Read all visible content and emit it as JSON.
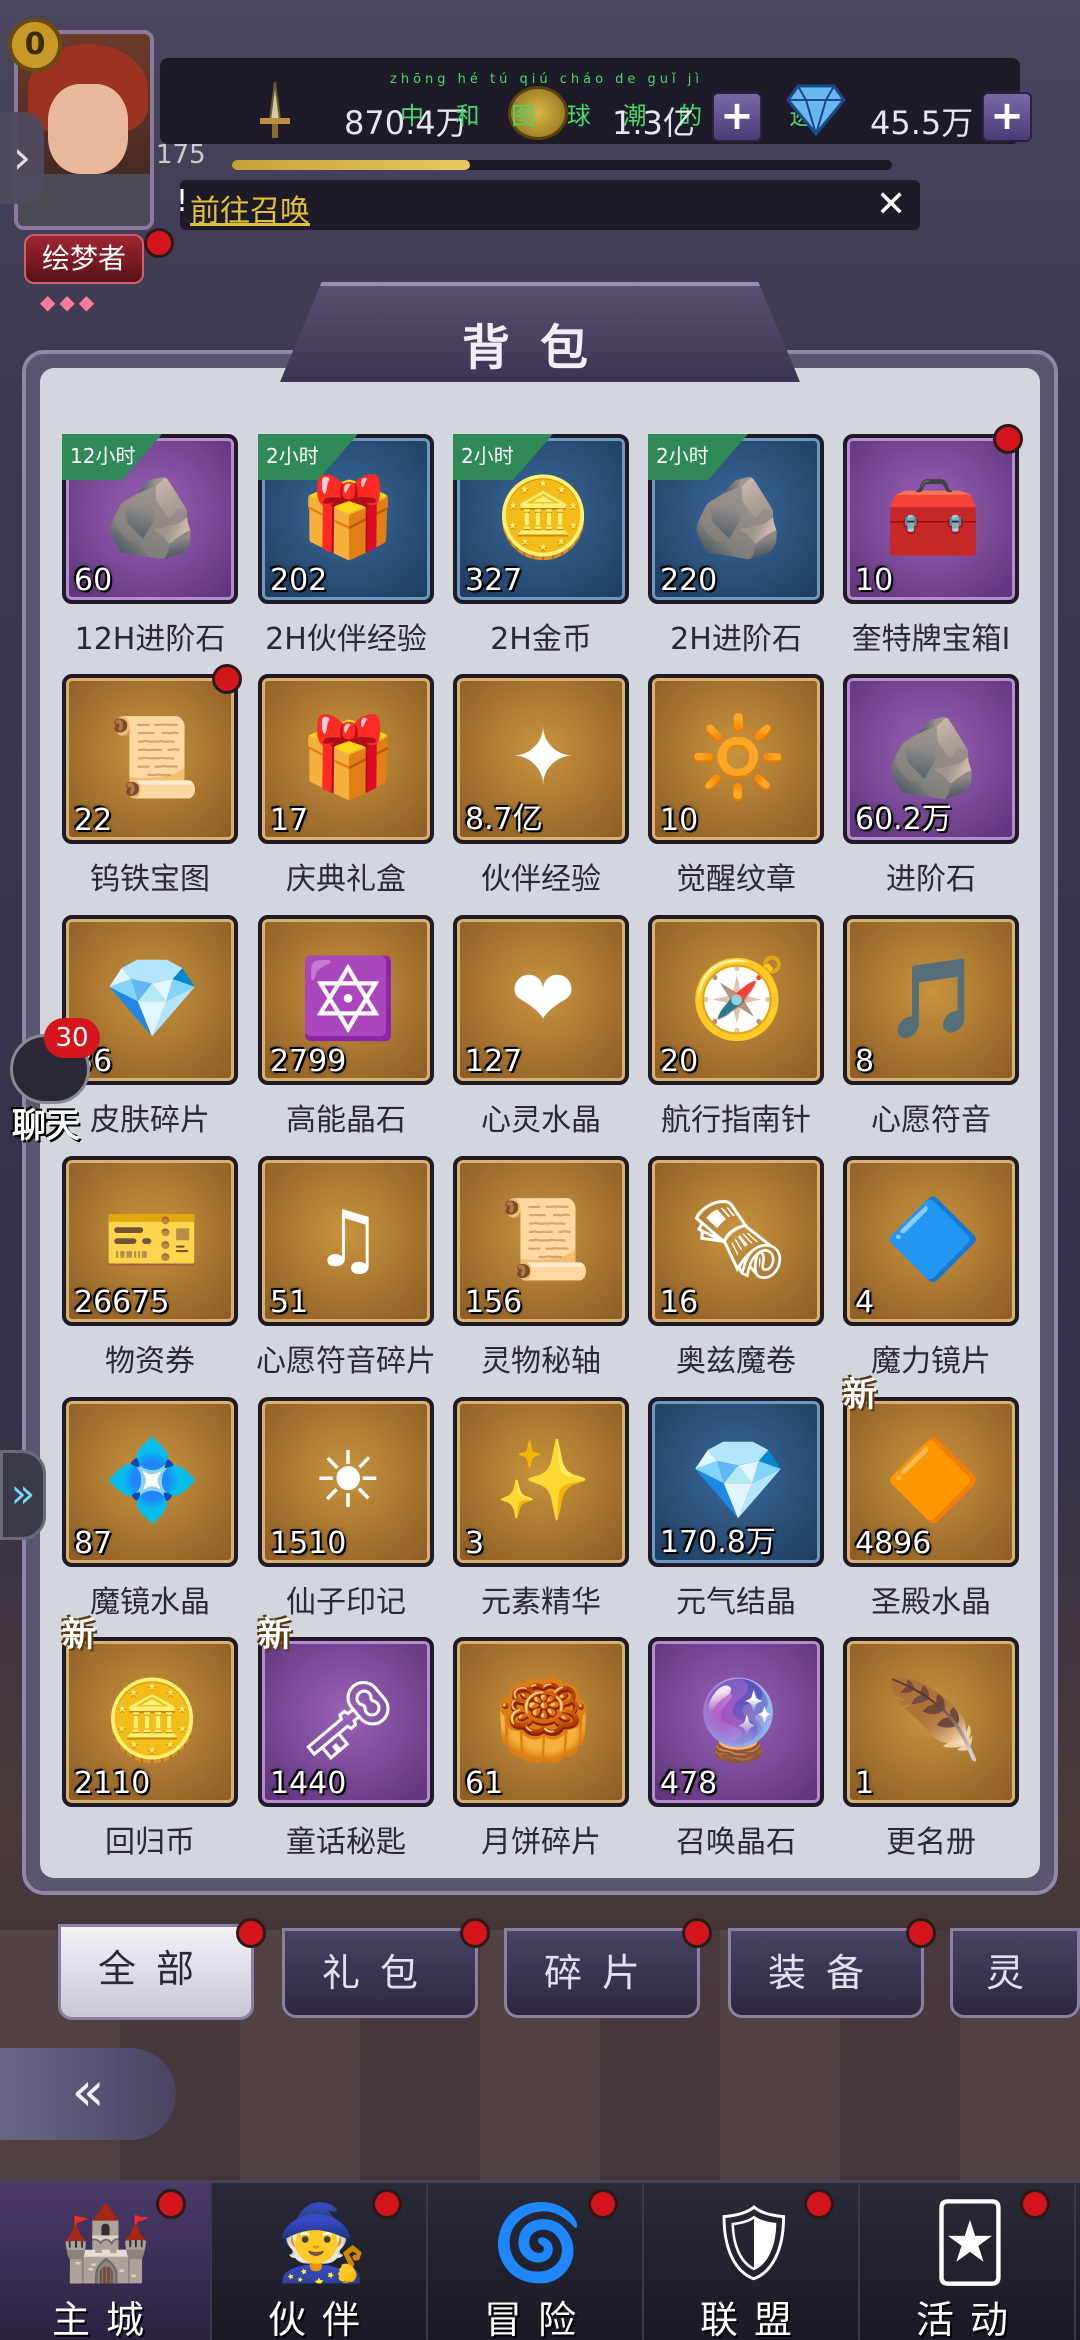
{
  "header": {
    "player_level": "0",
    "exp_level": "175",
    "exp_progress": 0.36,
    "title_badge": "绘梦者",
    "power": "870.4万",
    "gold_ruby": "zhōng hé tú qiú cháo de guǐ jì",
    "gold_line": "中 和 图 球 潮 的 轨 迹",
    "gold_value": "1.3亿",
    "diamonds": "45.5万",
    "quest_link": "前往召唤",
    "quest_prefix": "!"
  },
  "panel": {
    "title": "背包"
  },
  "items": [
    {
      "name": "12H进阶石",
      "count": "60",
      "frame": "purple",
      "ribbon": "12小时",
      "icon": "ore-icon",
      "glyph": "🪨",
      "dot": false,
      "new": false
    },
    {
      "name": "2H伙伴经验",
      "count": "202",
      "frame": "blue",
      "ribbon": "2小时",
      "icon": "gift-box-icon",
      "glyph": "🎁",
      "dot": false,
      "new": false
    },
    {
      "name": "2H金币",
      "count": "327",
      "frame": "blue",
      "ribbon": "2小时",
      "icon": "gold-coins-icon",
      "glyph": "🪙",
      "dot": false,
      "new": false
    },
    {
      "name": "2H进阶石",
      "count": "220",
      "frame": "blue",
      "ribbon": "2小时",
      "icon": "ore-icon",
      "glyph": "🪨",
      "dot": false,
      "new": false
    },
    {
      "name": "奎特牌宝箱I",
      "count": "10",
      "frame": "purple",
      "ribbon": "",
      "icon": "treasure-chest-icon",
      "glyph": "🧰",
      "dot": true,
      "new": false
    },
    {
      "name": "钨铁宝图",
      "count": "22",
      "frame": "gold",
      "ribbon": "",
      "icon": "map-scroll-icon",
      "glyph": "📜",
      "dot": true,
      "new": false
    },
    {
      "name": "庆典礼盒",
      "count": "17",
      "frame": "gold",
      "ribbon": "",
      "icon": "celebration-box-icon",
      "glyph": "🎁",
      "dot": false,
      "new": false
    },
    {
      "name": "伙伴经验",
      "count": "8.7亿",
      "frame": "gold",
      "ribbon": "",
      "icon": "exp-star-icon",
      "glyph": "✦",
      "dot": false,
      "new": false
    },
    {
      "name": "觉醒纹章",
      "count": "10",
      "frame": "gold",
      "ribbon": "",
      "icon": "emblem-icon",
      "glyph": "🔆",
      "dot": false,
      "new": false
    },
    {
      "name": "进阶石",
      "count": "60.2万",
      "frame": "purple",
      "ribbon": "",
      "icon": "ore-icon",
      "glyph": "🪨",
      "dot": false,
      "new": false
    },
    {
      "name": "皮肤碎片",
      "count": "36",
      "frame": "gold",
      "ribbon": "",
      "icon": "skin-shard-icon",
      "glyph": "💎",
      "dot": false,
      "new": false
    },
    {
      "name": "高能晶石",
      "count": "2799",
      "frame": "gold",
      "ribbon": "",
      "icon": "energy-crystal-icon",
      "glyph": "🔯",
      "dot": false,
      "new": false
    },
    {
      "name": "心灵水晶",
      "count": "127",
      "frame": "gold",
      "ribbon": "",
      "icon": "heart-crystal-icon",
      "glyph": "❤",
      "dot": false,
      "new": false
    },
    {
      "name": "航行指南针",
      "count": "20",
      "frame": "gold",
      "ribbon": "",
      "icon": "compass-icon",
      "glyph": "🧭",
      "dot": false,
      "new": false
    },
    {
      "name": "心愿符音",
      "count": "8",
      "frame": "gold",
      "ribbon": "",
      "icon": "music-note-stone-icon",
      "glyph": "🎵",
      "dot": false,
      "new": false
    },
    {
      "name": "物资券",
      "count": "26675",
      "frame": "gold",
      "ribbon": "",
      "icon": "ticket-icon",
      "glyph": "🎫",
      "dot": false,
      "new": false
    },
    {
      "name": "心愿符音碎片",
      "count": "51",
      "frame": "gold",
      "ribbon": "",
      "icon": "music-note-icon",
      "glyph": "♫",
      "dot": false,
      "new": false
    },
    {
      "name": "灵物秘轴",
      "count": "156",
      "frame": "gold",
      "ribbon": "",
      "icon": "scroll-icon",
      "glyph": "📜",
      "dot": false,
      "new": false
    },
    {
      "name": "奥兹魔卷",
      "count": "16",
      "frame": "gold",
      "ribbon": "",
      "icon": "magic-scroll-icon",
      "glyph": "🗞",
      "dot": false,
      "new": false
    },
    {
      "name": "魔力镜片",
      "count": "4",
      "frame": "gold",
      "ribbon": "",
      "icon": "mirror-shard-icon",
      "glyph": "🔷",
      "dot": false,
      "new": false
    },
    {
      "name": "魔镜水晶",
      "count": "87",
      "frame": "gold",
      "ribbon": "",
      "icon": "mirror-crystal-icon",
      "glyph": "💠",
      "dot": false,
      "new": false
    },
    {
      "name": "仙子印记",
      "count": "1510",
      "frame": "gold",
      "ribbon": "",
      "icon": "fairy-seal-icon",
      "glyph": "☀",
      "dot": false,
      "new": false
    },
    {
      "name": "元素精华",
      "count": "3",
      "frame": "gold",
      "ribbon": "",
      "icon": "element-essence-icon",
      "glyph": "✨",
      "dot": false,
      "new": false
    },
    {
      "name": "元气结晶",
      "count": "170.8万",
      "frame": "blue",
      "ribbon": "",
      "icon": "vitality-crystal-icon",
      "glyph": "💎",
      "dot": false,
      "new": false
    },
    {
      "name": "圣殿水晶",
      "count": "4896",
      "frame": "gold",
      "ribbon": "",
      "icon": "temple-crystal-icon",
      "glyph": "🔶",
      "dot": false,
      "new": true
    },
    {
      "name": "回归币",
      "count": "2110",
      "frame": "gold",
      "ribbon": "",
      "icon": "return-coin-icon",
      "glyph": "🪙",
      "dot": false,
      "new": true
    },
    {
      "name": "童话秘匙",
      "count": "1440",
      "frame": "purple",
      "ribbon": "",
      "icon": "key-icon",
      "glyph": "🗝",
      "dot": false,
      "new": true
    },
    {
      "name": "月饼碎片",
      "count": "61",
      "frame": "gold",
      "ribbon": "",
      "icon": "mooncake-icon",
      "glyph": "🥮",
      "dot": false,
      "new": false
    },
    {
      "name": "召唤晶石",
      "count": "478",
      "frame": "purple",
      "ribbon": "",
      "icon": "summon-crystal-icon",
      "glyph": "🔮",
      "dot": false,
      "new": false
    },
    {
      "name": "更名册",
      "count": "1",
      "frame": "gold",
      "ribbon": "",
      "icon": "quill-scroll-icon",
      "glyph": "🪶",
      "dot": false,
      "new": false
    }
  ],
  "item_labels": {
    "new": "新"
  },
  "tabs": [
    {
      "label": "全部",
      "active": true
    },
    {
      "label": "礼包",
      "active": false
    },
    {
      "label": "碎片",
      "active": false
    },
    {
      "label": "装备",
      "active": false
    },
    {
      "label": "灵",
      "active": false
    }
  ],
  "chat": {
    "badge": "30",
    "label": "聊天"
  },
  "nav": [
    {
      "label": "主城",
      "icon": "castle-icon",
      "glyph": "🏰",
      "active": true
    },
    {
      "label": "伙伴",
      "icon": "wizard-hat-icon",
      "glyph": "🧙",
      "active": false
    },
    {
      "label": "冒险",
      "icon": "adventure-portal-icon",
      "glyph": "🌀",
      "active": false
    },
    {
      "label": "联盟",
      "icon": "guild-shield-icon",
      "glyph": "🛡",
      "active": false
    },
    {
      "label": "活动",
      "icon": "cards-icon",
      "glyph": "🃏",
      "active": false
    }
  ],
  "colors": {
    "accent_gold": "#e0c238",
    "notification_red": "#d4161c",
    "ribbon_green": "#2f8a58"
  }
}
